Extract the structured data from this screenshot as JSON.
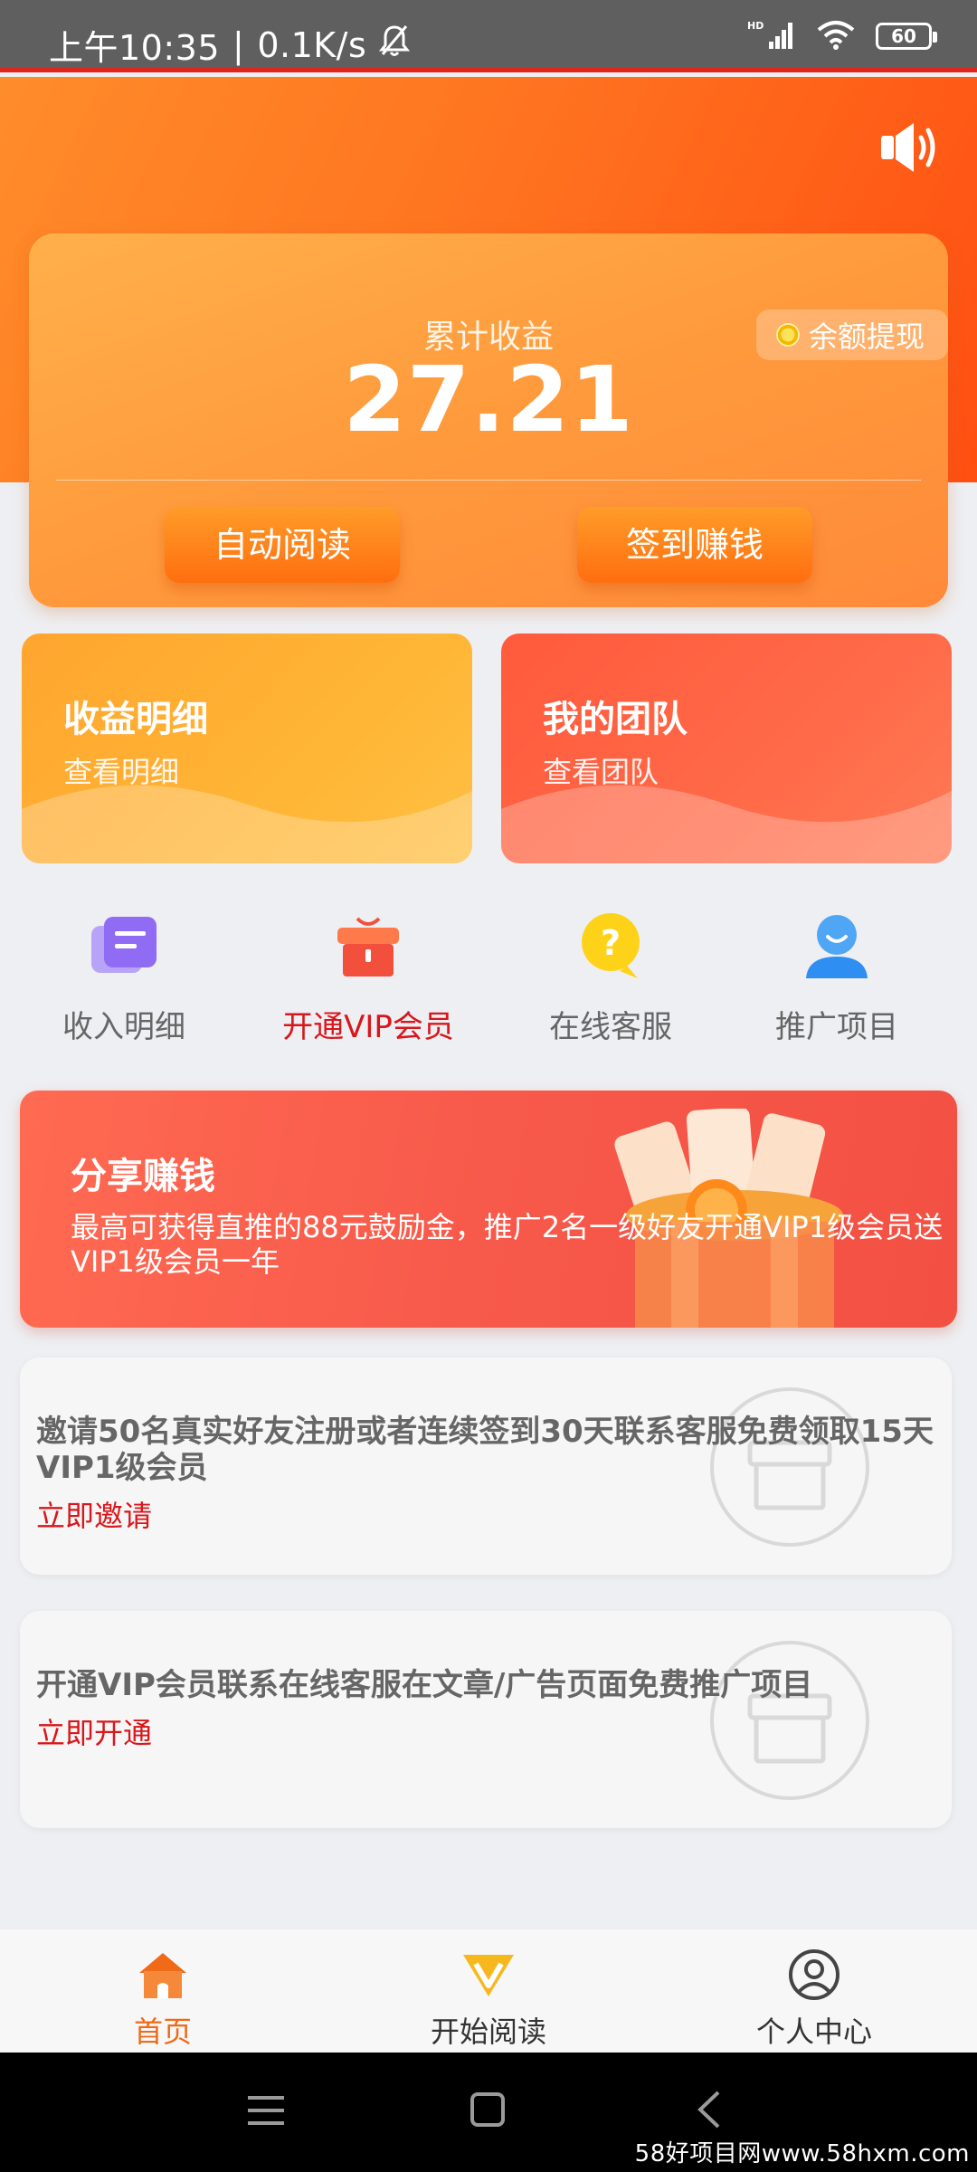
{
  "status_bar": {
    "time": "上午10:35",
    "speed": "0.1K/s",
    "network": "HD",
    "battery": "60"
  },
  "earnings": {
    "label": "累计收益",
    "value": "27.21",
    "withdraw_label": "余额提现",
    "auto_read_label": "自动阅读",
    "checkin_label": "签到赚钱"
  },
  "cards": [
    {
      "title": "收益明细",
      "subtitle": "查看明细"
    },
    {
      "title": "我的团队",
      "subtitle": "查看团队"
    }
  ],
  "quick_actions": [
    {
      "label": "收入明细",
      "icon": "document-icon",
      "highlight": false
    },
    {
      "label": "开通VIP会员",
      "icon": "gift-box-icon",
      "highlight": true
    },
    {
      "label": "在线客服",
      "icon": "help-chat-icon",
      "highlight": false
    },
    {
      "label": "推广项目",
      "icon": "user-icon",
      "highlight": false
    }
  ],
  "share": {
    "title": "分享赚钱",
    "description": "最高可获得直推的88元鼓励金，推广2名一级好友开通VIP1级会员送VIP1级会员一年"
  },
  "tasks": [
    {
      "text": "邀请50名真实好友注册或者连续签到30天联系客服免费领取15天VIP1级会员",
      "link": "立即邀请"
    },
    {
      "text": "开通VIP会员联系在线客服在文章/广告页面免费推广项目",
      "link": "立即开通"
    }
  ],
  "bottom_nav": [
    {
      "label": "首页",
      "icon": "home-icon",
      "active": true
    },
    {
      "label": "开始阅读",
      "icon": "diamond-v-icon",
      "active": false
    },
    {
      "label": "个人中心",
      "icon": "profile-icon",
      "active": false
    }
  ],
  "watermark": "58好项目网www.58hxm.com",
  "colors": {
    "primary_orange": "#ff7a22",
    "active_red": "#d9161b",
    "nav_active": "#f06a17"
  }
}
